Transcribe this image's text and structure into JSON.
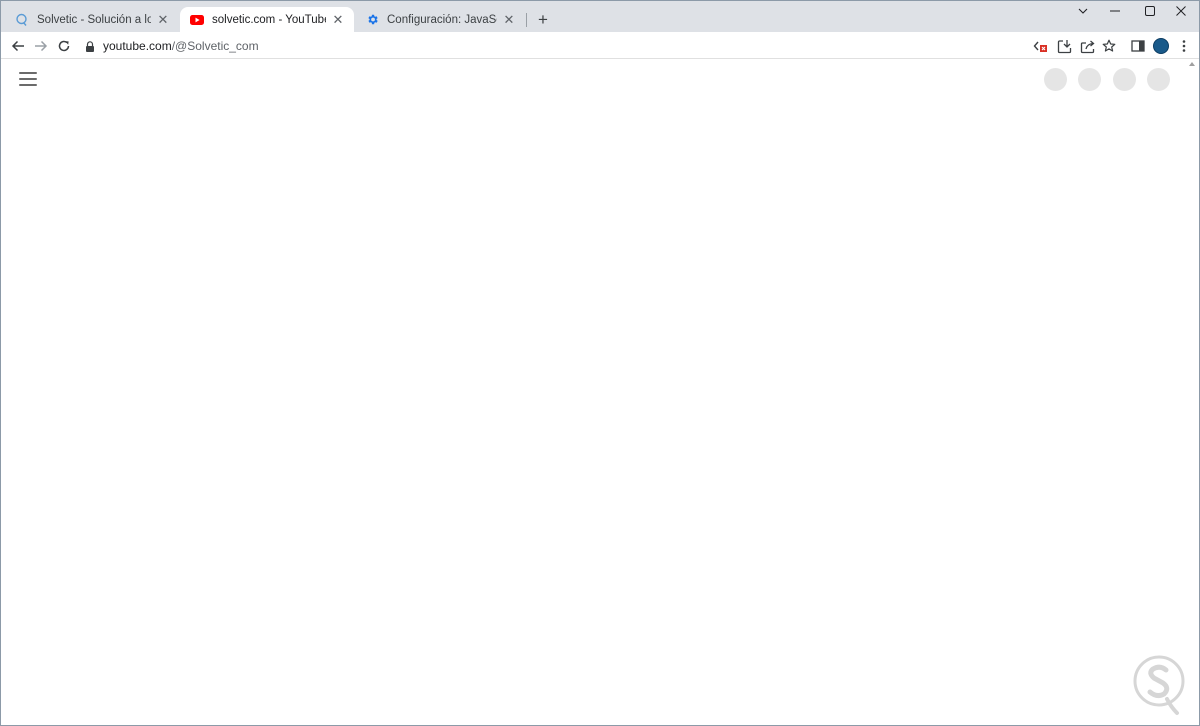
{
  "browser": {
    "tabs": [
      {
        "title": "Solvetic - Solución a los problem",
        "favicon": "solvetic-icon",
        "active": false
      },
      {
        "title": "solvetic.com - YouTube",
        "favicon": "youtube-icon",
        "active": true
      },
      {
        "title": "Configuración: JavaScript",
        "favicon": "gear-icon",
        "active": false
      }
    ],
    "new_tab_label": "+",
    "window_controls": [
      "chevron-down-icon",
      "minimize-icon",
      "maximize-icon",
      "close-icon"
    ],
    "address": {
      "host": "youtube.com",
      "path": "/@Solvetic_com"
    },
    "toolbar_icons": [
      "javascript-blocked-icon",
      "install-app-icon",
      "share-icon",
      "bookmark-star-icon",
      "side-panel-icon",
      "profile-avatar",
      "menu-dots-icon"
    ]
  },
  "page": {
    "skeleton_placeholders": 4
  },
  "colors": {
    "tabstrip": "#dee1e6",
    "youtube_red": "#ff0000",
    "gear_blue": "#1a73e8",
    "blocked_red": "#d93025",
    "skeleton": "#e5e5e5",
    "profile": "#1a5a8a"
  }
}
